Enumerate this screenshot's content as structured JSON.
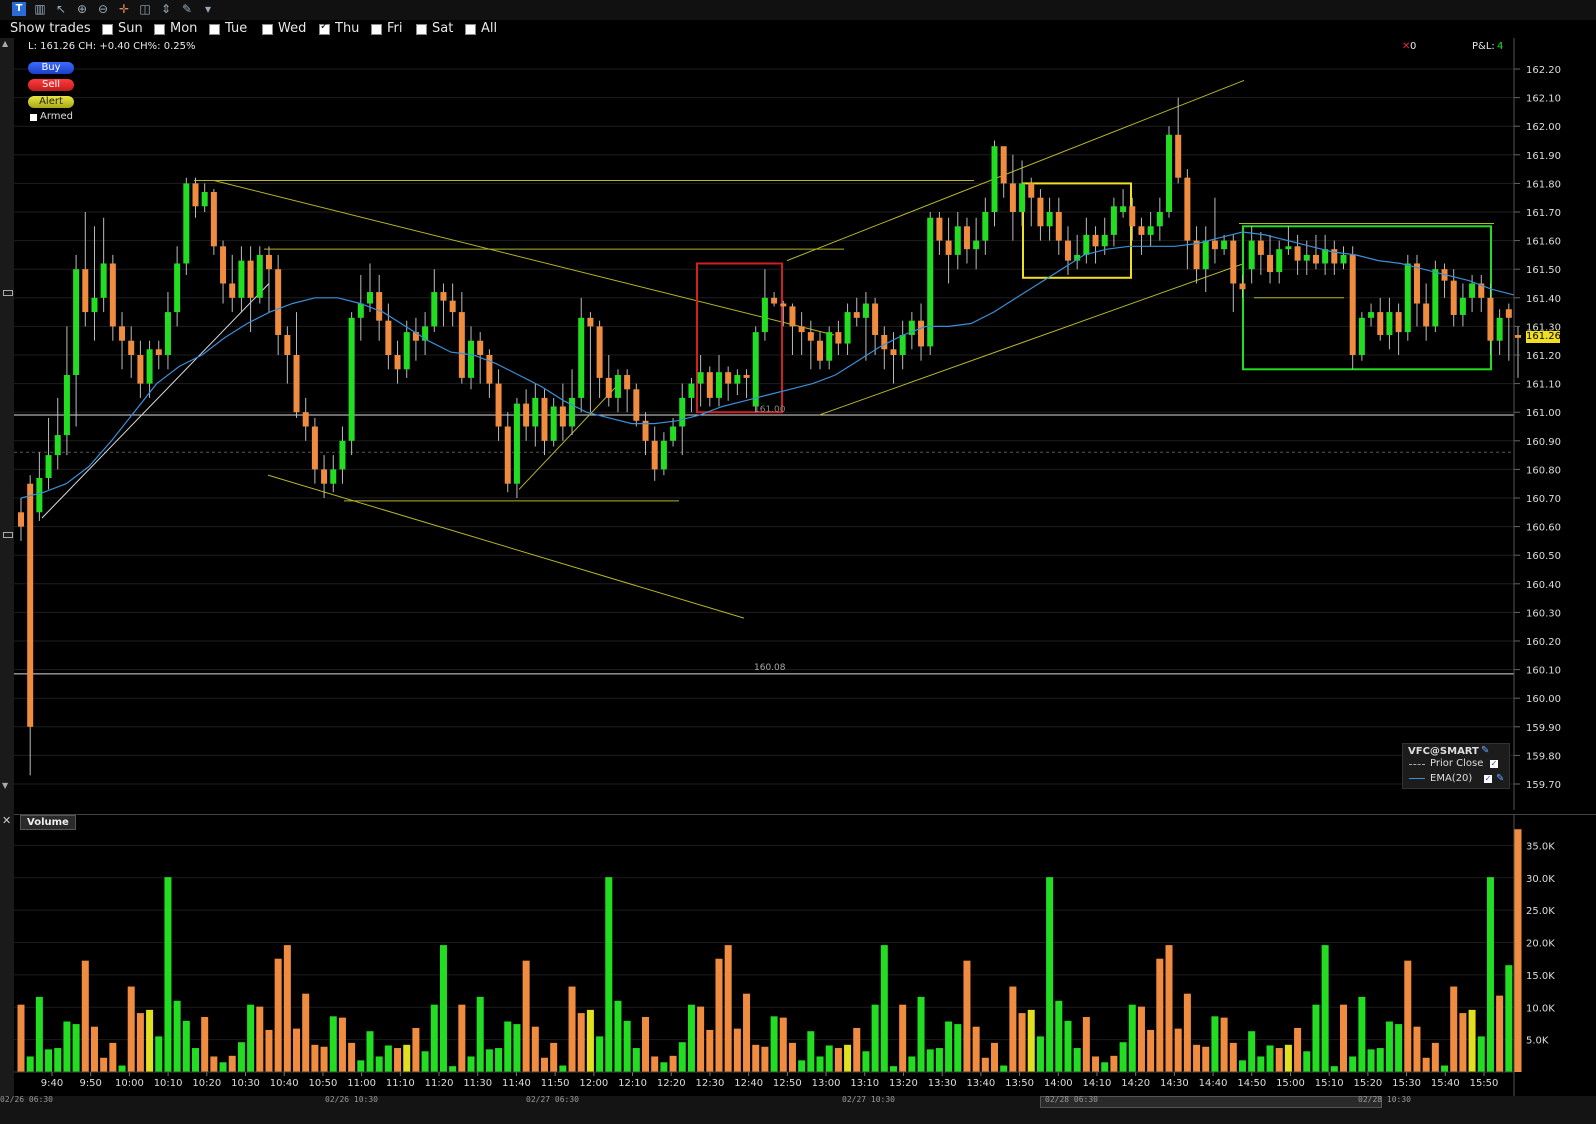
{
  "toolbar": {
    "icons": [
      "app-icon",
      "bars-icon",
      "cursor-icon",
      "zoom-in-icon",
      "zoom-out-icon",
      "crosshair-icon",
      "split-icon",
      "scroll-icon",
      "wrench-icon",
      "dropdown-icon"
    ]
  },
  "show_trades": {
    "label": "Show trades",
    "days": [
      {
        "label": "Sun",
        "checked": false
      },
      {
        "label": "Mon",
        "checked": false
      },
      {
        "label": "Tue",
        "checked": false
      },
      {
        "label": "Wed",
        "checked": false
      },
      {
        "label": "Thu",
        "checked": true
      },
      {
        "label": "Fri",
        "checked": false
      },
      {
        "label": "Sat",
        "checked": false
      },
      {
        "label": "All",
        "checked": false
      }
    ]
  },
  "info_line": "L: 161.26 CH: +0.40 CH%: 0.25%",
  "position_count": "0",
  "pnl_label": "P&L:",
  "pnl_value": "4",
  "order_buttons": {
    "buy": "Buy",
    "sell": "Sell",
    "alert": "Alert",
    "armed": "Armed"
  },
  "legend": {
    "symbol": "VFC@SMART",
    "prior_close": "Prior Close",
    "ema": "EMA(20)"
  },
  "volume_label": "Volume",
  "price_tag": "161.26",
  "line_labels": {
    "level_161": "161.00",
    "level_160_08": "160.08"
  },
  "date_labels": [
    "02/26 06:30",
    "02/26 10:30",
    "02/27 06:30",
    "02/27 10:30",
    "02/28 06:30",
    "02/28 10:30"
  ],
  "colors": {
    "up": "#22dd22",
    "down": "#f08c40",
    "ema": "#3a8fd8",
    "trendline": "#b5b52a",
    "red_box": "#d02020",
    "yellow_box": "#f0e020",
    "green_box": "#22dd22",
    "background": "#000000",
    "volume_highlight": "#e0e020"
  },
  "chart_data": {
    "type": "candlestick",
    "y_ticks": [
      "162.20",
      "162.10",
      "162.00",
      "161.90",
      "161.80",
      "161.70",
      "161.60",
      "161.50",
      "161.40",
      "161.30",
      "161.20",
      "161.10",
      "161.00",
      "160.90",
      "160.80",
      "160.70",
      "160.60",
      "160.50",
      "160.40",
      "160.30",
      "160.20",
      "160.10",
      "160.00",
      "159.90",
      "159.80",
      "159.70"
    ],
    "ylim": [
      159.66,
      162.26
    ],
    "x_ticks": [
      "9:40",
      "9:50",
      "10:00",
      "10:10",
      "10:20",
      "10:30",
      "10:40",
      "10:50",
      "11:00",
      "11:10",
      "11:20",
      "11:30",
      "11:40",
      "11:50",
      "12:00",
      "12:10",
      "12:20",
      "12:30",
      "12:40",
      "12:50",
      "13:00",
      "13:10",
      "13:20",
      "13:30",
      "13:40",
      "13:50",
      "14:00",
      "14:10",
      "14:20",
      "14:30",
      "14:40",
      "14:50",
      "15:00",
      "15:10",
      "15:20",
      "15:30",
      "15:40",
      "15:50"
    ],
    "candles": [
      [
        160.65,
        160.6,
        160.7,
        160.55
      ],
      [
        160.75,
        159.9,
        160.78,
        159.73
      ],
      [
        160.65,
        160.77,
        160.86,
        160.62
      ],
      [
        160.77,
        160.85,
        160.98,
        160.73
      ],
      [
        160.85,
        160.92,
        161.05,
        160.8
      ],
      [
        160.92,
        161.13,
        161.3,
        160.85
      ],
      [
        161.13,
        161.5,
        161.55,
        160.95
      ],
      [
        161.5,
        161.35,
        161.7,
        161.3
      ],
      [
        161.35,
        161.4,
        161.65,
        161.25
      ],
      [
        161.4,
        161.52,
        161.68,
        161.35
      ],
      [
        161.52,
        161.3,
        161.55,
        161.25
      ],
      [
        161.3,
        161.25,
        161.35,
        161.15
      ],
      [
        161.25,
        161.2,
        161.3,
        161.12
      ],
      [
        161.2,
        161.1,
        161.25,
        161.05
      ],
      [
        161.1,
        161.22,
        161.25,
        161.05
      ],
      [
        161.22,
        161.2,
        161.25,
        161.15
      ],
      [
        161.2,
        161.35,
        161.42,
        161.15
      ],
      [
        161.35,
        161.52,
        161.58,
        161.3
      ],
      [
        161.52,
        161.8,
        161.82,
        161.48
      ],
      [
        161.8,
        161.72,
        161.82,
        161.68
      ],
      [
        161.72,
        161.77,
        161.8,
        161.7
      ],
      [
        161.77,
        161.58,
        161.78,
        161.55
      ],
      [
        161.58,
        161.45,
        161.6,
        161.38
      ],
      [
        161.45,
        161.4,
        161.55,
        161.35
      ],
      [
        161.4,
        161.53,
        161.58,
        161.35
      ],
      [
        161.53,
        161.4,
        161.58,
        161.28
      ],
      [
        161.4,
        161.55,
        161.58,
        161.38
      ],
      [
        161.55,
        161.5,
        161.58,
        161.35
      ],
      [
        161.5,
        161.27,
        161.55,
        161.2
      ],
      [
        161.27,
        161.2,
        161.3,
        161.1
      ],
      [
        161.2,
        161.0,
        161.35,
        160.98
      ],
      [
        161.0,
        160.95,
        161.05,
        160.9
      ],
      [
        160.95,
        160.8,
        160.98,
        160.75
      ],
      [
        160.8,
        160.75,
        160.85,
        160.7
      ],
      [
        160.75,
        160.8,
        160.85,
        160.72
      ],
      [
        160.8,
        160.9,
        160.95,
        160.75
      ],
      [
        160.9,
        161.33,
        161.35,
        160.85
      ],
      [
        161.33,
        161.38,
        161.48,
        161.25
      ],
      [
        161.38,
        161.42,
        161.52,
        161.35
      ],
      [
        161.42,
        161.32,
        161.48,
        161.25
      ],
      [
        161.32,
        161.2,
        161.38,
        161.15
      ],
      [
        161.2,
        161.15,
        161.25,
        161.1
      ],
      [
        161.15,
        161.28,
        161.32,
        161.12
      ],
      [
        161.28,
        161.25,
        161.33,
        161.18
      ],
      [
        161.25,
        161.3,
        161.35,
        161.2
      ],
      [
        161.3,
        161.42,
        161.5,
        161.28
      ],
      [
        161.42,
        161.39,
        161.45,
        161.3
      ],
      [
        161.39,
        161.35,
        161.45,
        161.3
      ],
      [
        161.35,
        161.12,
        161.42,
        161.1
      ],
      [
        161.12,
        161.25,
        161.3,
        161.08
      ],
      [
        161.25,
        161.2,
        161.28,
        161.1
      ],
      [
        161.2,
        161.1,
        161.22,
        161.05
      ],
      [
        161.1,
        160.95,
        161.15,
        160.9
      ],
      [
        160.95,
        160.75,
        161.0,
        160.72
      ],
      [
        160.75,
        161.03,
        161.05,
        160.7
      ],
      [
        161.03,
        160.95,
        161.08,
        160.9
      ],
      [
        160.95,
        161.05,
        161.1,
        160.88
      ],
      [
        161.05,
        160.9,
        161.08,
        160.85
      ],
      [
        160.9,
        161.02,
        161.05,
        160.88
      ],
      [
        161.02,
        160.95,
        161.1,
        160.9
      ],
      [
        160.95,
        161.05,
        161.15,
        160.92
      ],
      [
        161.05,
        161.33,
        161.4,
        161.0
      ],
      [
        161.33,
        161.3,
        161.35,
        161.0
      ],
      [
        161.3,
        161.12,
        161.32,
        161.05
      ],
      [
        161.12,
        161.05,
        161.2,
        161.02
      ],
      [
        161.05,
        161.13,
        161.15,
        161.0
      ],
      [
        161.13,
        161.08,
        161.15,
        161.0
      ],
      [
        161.08,
        160.97,
        161.1,
        160.95
      ],
      [
        160.97,
        160.9,
        161.0,
        160.85
      ],
      [
        160.9,
        160.8,
        160.95,
        160.76
      ],
      [
        160.8,
        160.9,
        160.93,
        160.78
      ],
      [
        160.9,
        160.95,
        160.98,
        160.88
      ],
      [
        160.95,
        161.05,
        161.1,
        160.85
      ],
      [
        161.05,
        161.1,
        161.12,
        161.0
      ],
      [
        161.1,
        161.14,
        161.2,
        161.02
      ],
      [
        161.14,
        161.05,
        161.16,
        161.02
      ],
      [
        161.05,
        161.14,
        161.2,
        161.02
      ],
      [
        161.14,
        161.1,
        161.16,
        161.04
      ],
      [
        161.1,
        161.13,
        161.15,
        161.06
      ],
      [
        161.13,
        161.12,
        161.15,
        161.05
      ],
      [
        161.02,
        161.28,
        161.3,
        161.0
      ],
      [
        161.28,
        161.4,
        161.5,
        161.25
      ],
      [
        161.4,
        161.38,
        161.42,
        161.37
      ],
      [
        161.38,
        161.37,
        161.39,
        161.3
      ],
      [
        161.37,
        161.3,
        161.38,
        161.2
      ],
      [
        161.3,
        161.28,
        161.35,
        161.2
      ],
      [
        161.28,
        161.25,
        161.32,
        161.15
      ],
      [
        161.25,
        161.18,
        161.28,
        161.15
      ],
      [
        161.18,
        161.28,
        161.3,
        161.15
      ],
      [
        161.28,
        161.24,
        161.32,
        161.2
      ],
      [
        161.24,
        161.35,
        161.38,
        161.2
      ],
      [
        161.35,
        161.33,
        161.4,
        161.3
      ],
      [
        161.33,
        161.38,
        161.42,
        161.18
      ],
      [
        161.38,
        161.27,
        161.4,
        161.2
      ],
      [
        161.27,
        161.22,
        161.3,
        161.15
      ],
      [
        161.22,
        161.2,
        161.28,
        161.1
      ],
      [
        161.2,
        161.27,
        161.32,
        161.15
      ],
      [
        161.27,
        161.32,
        161.35,
        161.22
      ],
      [
        161.32,
        161.23,
        161.38,
        161.18
      ],
      [
        161.23,
        161.68,
        161.7,
        161.2
      ],
      [
        161.68,
        161.6,
        161.7,
        161.55
      ],
      [
        161.6,
        161.55,
        161.68,
        161.45
      ],
      [
        161.55,
        161.65,
        161.7,
        161.5
      ],
      [
        161.65,
        161.57,
        161.68,
        161.52
      ],
      [
        161.57,
        161.6,
        161.68,
        161.5
      ],
      [
        161.6,
        161.7,
        161.75,
        161.55
      ],
      [
        161.7,
        161.93,
        161.95,
        161.65
      ],
      [
        161.93,
        161.8,
        161.9,
        161.75
      ],
      [
        161.8,
        161.7,
        161.9,
        161.6
      ],
      [
        161.7,
        161.8,
        161.88,
        161.65
      ],
      [
        161.8,
        161.75,
        161.82,
        161.65
      ],
      [
        161.75,
        161.65,
        161.78,
        161.6
      ],
      [
        161.65,
        161.7,
        161.75,
        161.6
      ],
      [
        161.7,
        161.6,
        161.75,
        161.55
      ],
      [
        161.6,
        161.53,
        161.65,
        161.48
      ],
      [
        161.53,
        161.55,
        161.62,
        161.5
      ],
      [
        161.55,
        161.62,
        161.68,
        161.52
      ],
      [
        161.62,
        161.58,
        161.65,
        161.52
      ],
      [
        161.58,
        161.62,
        161.68,
        161.55
      ],
      [
        161.62,
        161.72,
        161.75,
        161.58
      ],
      [
        161.7,
        161.72,
        161.78,
        161.68
      ],
      [
        161.72,
        161.65,
        161.75,
        161.6
      ],
      [
        161.65,
        161.62,
        161.68,
        161.55
      ],
      [
        161.62,
        161.65,
        161.7,
        161.58
      ],
      [
        161.65,
        161.7,
        161.75,
        161.6
      ],
      [
        161.7,
        161.97,
        162.0,
        161.68
      ],
      [
        161.97,
        161.82,
        162.1,
        161.8
      ],
      [
        161.82,
        161.6,
        161.85,
        161.5
      ],
      [
        161.6,
        161.5,
        161.65,
        161.45
      ],
      [
        161.5,
        161.6,
        161.65,
        161.42
      ],
      [
        161.6,
        161.57,
        161.75,
        161.52
      ],
      [
        161.57,
        161.6,
        161.62,
        161.55
      ],
      [
        161.6,
        161.45,
        161.62,
        161.35
      ],
      [
        161.45,
        161.43,
        161.48,
        161.4
      ],
      [
        161.5,
        161.6,
        161.65,
        161.45
      ],
      [
        161.6,
        161.55,
        161.63,
        161.48
      ],
      [
        161.55,
        161.49,
        161.62,
        161.45
      ],
      [
        161.49,
        161.57,
        161.6,
        161.45
      ],
      [
        161.57,
        161.58,
        161.65,
        161.55
      ],
      [
        161.58,
        161.53,
        161.62,
        161.48
      ],
      [
        161.53,
        161.55,
        161.6,
        161.48
      ],
      [
        161.55,
        161.52,
        161.62,
        161.5
      ],
      [
        161.52,
        161.57,
        161.62,
        161.48
      ],
      [
        161.57,
        161.52,
        161.6,
        161.48
      ],
      [
        161.52,
        161.55,
        161.58,
        161.5
      ],
      [
        161.55,
        161.2,
        161.58,
        161.15
      ],
      [
        161.2,
        161.33,
        161.35,
        161.18
      ],
      [
        161.33,
        161.35,
        161.38,
        161.3
      ],
      [
        161.35,
        161.27,
        161.4,
        161.25
      ],
      [
        161.27,
        161.35,
        161.4,
        161.22
      ],
      [
        161.35,
        161.28,
        161.38,
        161.2
      ],
      [
        161.28,
        161.52,
        161.55,
        161.25
      ],
      [
        161.52,
        161.38,
        161.55,
        161.3
      ],
      [
        161.38,
        161.3,
        161.45,
        161.25
      ],
      [
        161.3,
        161.5,
        161.53,
        161.28
      ],
      [
        161.5,
        161.46,
        161.52,
        161.4
      ],
      [
        161.46,
        161.34,
        161.5,
        161.3
      ],
      [
        161.34,
        161.4,
        161.45,
        161.3
      ],
      [
        161.4,
        161.45,
        161.48,
        161.35
      ],
      [
        161.45,
        161.4,
        161.48,
        161.35
      ],
      [
        161.4,
        161.25,
        161.45,
        161.2
      ],
      [
        161.25,
        161.33,
        161.36,
        161.2
      ],
      [
        161.36,
        161.33,
        161.38,
        161.18
      ],
      [
        161.27,
        161.26,
        161.3,
        161.12
      ]
    ],
    "ema20": [
      160.7,
      160.72,
      160.75,
      160.81,
      160.9,
      161.0,
      161.1,
      161.16,
      161.2,
      161.26,
      161.31,
      161.35,
      161.38,
      161.4,
      161.4,
      161.38,
      161.35,
      161.3,
      161.25,
      161.21,
      161.2,
      161.17,
      161.13,
      161.09,
      161.04,
      161.0,
      160.98,
      160.96,
      160.96,
      160.97,
      160.99,
      161.02,
      161.04,
      161.06,
      161.08,
      161.1,
      161.13,
      161.18,
      161.23,
      161.27,
      161.3,
      161.3,
      161.31,
      161.35,
      161.4,
      161.45,
      161.5,
      161.55,
      161.57,
      161.58,
      161.58,
      161.58,
      161.59,
      161.61,
      161.63,
      161.62,
      161.6,
      161.58,
      161.56,
      161.55,
      161.53,
      161.52,
      161.5,
      161.48,
      161.46,
      161.43,
      161.41
    ],
    "volume": [
      {
        "v": 10400,
        "c": "down"
      },
      {
        "v": 2400,
        "c": "up"
      },
      {
        "v": 11600,
        "c": "up"
      },
      {
        "v": 3500,
        "c": "up"
      },
      {
        "v": 3700,
        "c": "up"
      },
      {
        "v": 7800,
        "c": "up"
      },
      {
        "v": 7400,
        "c": "up"
      },
      {
        "v": 17200,
        "c": "down"
      },
      {
        "v": 7000,
        "c": "down"
      },
      {
        "v": 2200,
        "c": "down"
      },
      {
        "v": 4500,
        "c": "down"
      },
      {
        "v": 1000,
        "c": "up"
      },
      {
        "v": 13200,
        "c": "down"
      },
      {
        "v": 9100,
        "c": "down"
      },
      {
        "v": 9600,
        "c": "highlight"
      },
      {
        "v": 5500,
        "c": "up"
      },
      {
        "v": 30100,
        "c": "up"
      },
      {
        "v": 11000,
        "c": "up"
      },
      {
        "v": 7900,
        "c": "up"
      },
      {
        "v": 3700,
        "c": "up"
      },
      {
        "v": 8500,
        "c": "down"
      },
      {
        "v": 2400,
        "c": "down"
      },
      {
        "v": 1500,
        "c": "up"
      },
      {
        "v": 2500,
        "c": "down"
      },
      {
        "v": 4600,
        "c": "up"
      },
      {
        "v": 10400,
        "c": "up"
      },
      {
        "v": 10100,
        "c": "down"
      },
      {
        "v": 6500,
        "c": "down"
      },
      {
        "v": 17500,
        "c": "down"
      },
      {
        "v": 19600,
        "c": "down"
      },
      {
        "v": 6700,
        "c": "down"
      },
      {
        "v": 12100,
        "c": "down"
      },
      {
        "v": 4200,
        "c": "down"
      },
      {
        "v": 3900,
        "c": "down"
      },
      {
        "v": 8600,
        "c": "up"
      },
      {
        "v": 8400,
        "c": "down"
      },
      {
        "v": 4500,
        "c": "down"
      },
      {
        "v": 1800,
        "c": "up"
      },
      {
        "v": 6300,
        "c": "up"
      },
      {
        "v": 2400,
        "c": "up"
      },
      {
        "v": 4100,
        "c": "up"
      },
      {
        "v": 3700,
        "c": "down"
      },
      {
        "v": 4200,
        "c": "highlight"
      },
      {
        "v": 6800,
        "c": "down"
      },
      {
        "v": 3200,
        "c": "up"
      },
      {
        "v": 10400,
        "c": "up"
      },
      {
        "v": 19600,
        "c": "up"
      },
      {
        "v": 900,
        "c": "up"
      }
    ],
    "volume_y_ticks": [
      "35.0K",
      "30.0K",
      "25.0K",
      "20.0K",
      "15.0K",
      "10.0K",
      "5.0K"
    ],
    "volume_ylim": [
      0,
      38000
    ]
  }
}
